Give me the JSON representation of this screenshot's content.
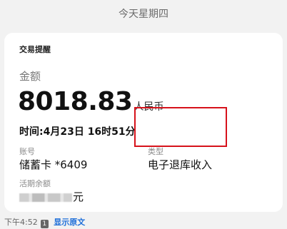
{
  "date_header": "今天星期四",
  "card": {
    "title": "交易提醒",
    "amount_label": "金额",
    "amount_value": "8018.83",
    "amount_unit": "人民币",
    "time_line": "时间:4月23日 16时51分",
    "account_label": "账号",
    "account_value": "储蓄卡 *6409",
    "type_label": "类型",
    "type_value": "电子退库收入",
    "balance_label": "活期余额",
    "balance_unit": "元"
  },
  "footer": {
    "time": "下午4:52",
    "badge": "1",
    "show_original": "显示原文"
  },
  "colors": {
    "background": "#f2f2f2",
    "card": "#ffffff",
    "highlight_border": "#d6121b",
    "link": "#1e6fd9"
  }
}
